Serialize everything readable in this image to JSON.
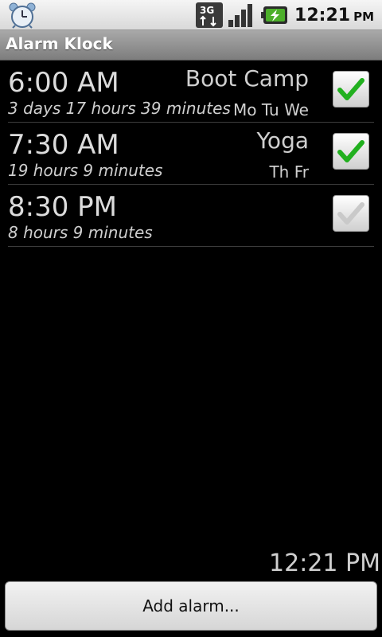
{
  "status_bar": {
    "time": "12:21",
    "ampm": "PM",
    "network": "3G",
    "icons": [
      "alarm-clock-icon",
      "3g-data-icon",
      "signal-strength-icon",
      "battery-charging-icon"
    ]
  },
  "app": {
    "title": "Alarm Klock"
  },
  "alarms": [
    {
      "time": "6:00 AM",
      "remaining": "3 days 17 hours 39 minutes",
      "label": "Boot Camp",
      "days": "Mo Tu We",
      "enabled": true
    },
    {
      "time": "7:30 AM",
      "remaining": "19 hours 9 minutes",
      "label": "Yoga",
      "days": "Th Fr",
      "enabled": true
    },
    {
      "time": "8:30 PM",
      "remaining": "8 hours 9 minutes",
      "label": "",
      "days": "",
      "enabled": false
    }
  ],
  "footer": {
    "current_time": "12:21 PM",
    "add_button_label": "Add alarm..."
  },
  "colors": {
    "check_enabled": "#22b01f",
    "check_disabled": "#c9c9c9"
  }
}
